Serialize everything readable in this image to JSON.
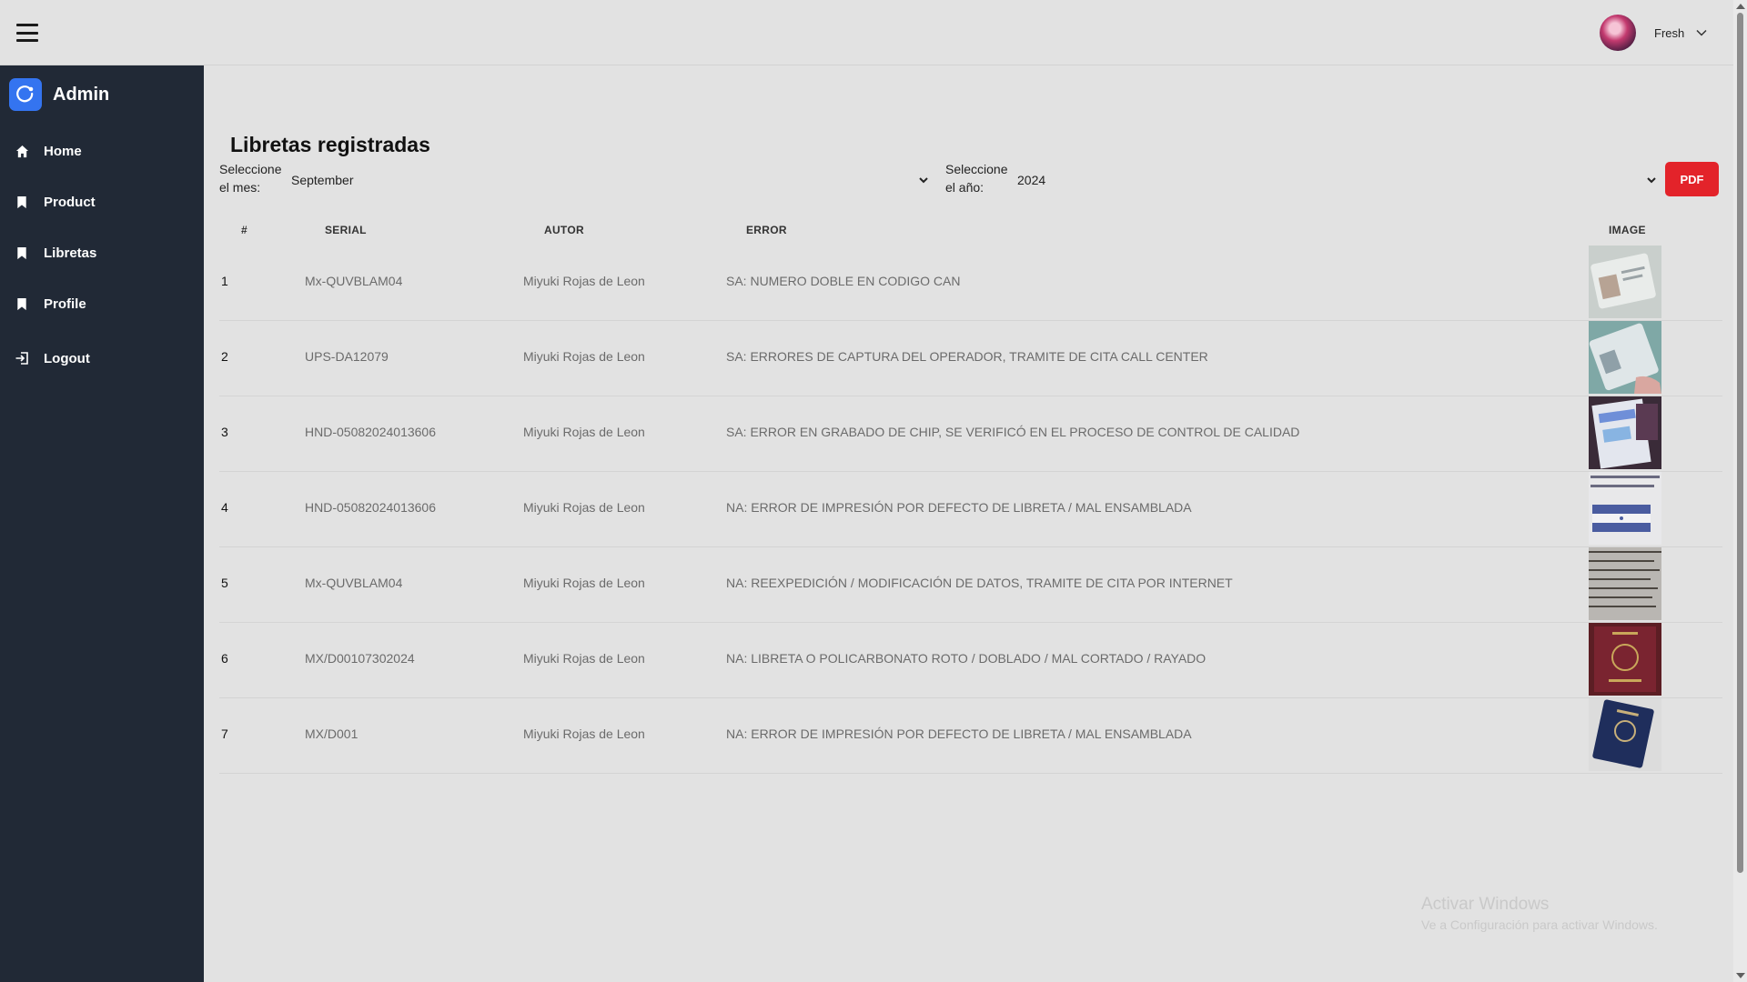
{
  "topbar": {
    "user_name": "Fresh"
  },
  "sidebar": {
    "brand": "Admin",
    "items": [
      {
        "label": "Home",
        "icon": "home-icon"
      },
      {
        "label": "Product",
        "icon": "bookmark-icon"
      },
      {
        "label": "Libretas",
        "icon": "bookmark-icon"
      },
      {
        "label": "Profile",
        "icon": "bookmark-icon"
      },
      {
        "label": "Logout",
        "icon": "logout-icon"
      }
    ]
  },
  "main": {
    "title": "Libretas registradas",
    "month_label": "Seleccione\nel mes:",
    "month_value": "September",
    "year_label": "Seleccione\nel año:",
    "year_value": "2024",
    "pdf_label": "PDF",
    "columns": {
      "num": "#",
      "serial": "SERIAL",
      "autor": "AUTOR",
      "error": "ERROR",
      "image": "IMAGE"
    },
    "rows": [
      {
        "num": "1",
        "serial": "Mx-QUVBLAM04",
        "autor": "Miyuki Rojas de Leon",
        "error": "SA: NUMERO DOBLE EN CODIGO CAN",
        "image": "id-card-photo"
      },
      {
        "num": "2",
        "serial": "UPS-DA12079",
        "autor": "Miyuki Rojas de Leon",
        "error": "SA: ERRORES DE CAPTURA DEL OPERADOR, TRAMITE DE CITA CALL CENTER",
        "image": "id-card-photo"
      },
      {
        "num": "3",
        "serial": "HND-05082024013606",
        "autor": "Miyuki Rojas de Leon",
        "error": "SA: ERROR EN GRABADO DE CHIP, SE VERIFICÓ EN EL PROCESO DE CONTROL DE CALIDAD",
        "image": "passport-pages-photo"
      },
      {
        "num": "4",
        "serial": "HND-05082024013606",
        "autor": "Miyuki Rojas de Leon",
        "error": "NA: ERROR DE IMPRESIÓN POR DEFECTO DE LIBRETA / MAL ENSAMBLADA",
        "image": "honduras-passport-page-photo"
      },
      {
        "num": "5",
        "serial": "Mx-QUVBLAM04",
        "autor": "Miyuki Rojas de Leon",
        "error": "NA: REEXPEDICIÓN / MODIFICACIÓN DE DATOS, TRAMITE DE CITA POR INTERNET",
        "image": "document-text-photo"
      },
      {
        "num": "6",
        "serial": "MX/D00107302024",
        "autor": "Miyuki Rojas de Leon",
        "error": "NA: LIBRETA O POLICARBONATO ROTO / DOBLADO / MAL CORTADO / RAYADO",
        "image": "red-passport-photo"
      },
      {
        "num": "7",
        "serial": "MX/D001",
        "autor": "Miyuki Rojas de Leon",
        "error": "NA: ERROR DE IMPRESIÓN POR DEFECTO DE LIBRETA / MAL ENSAMBLADA",
        "image": "blue-passport-photo"
      }
    ]
  },
  "watermark": {
    "line1": "Activar Windows",
    "line2": "Ve a Configuración para activar Windows."
  }
}
